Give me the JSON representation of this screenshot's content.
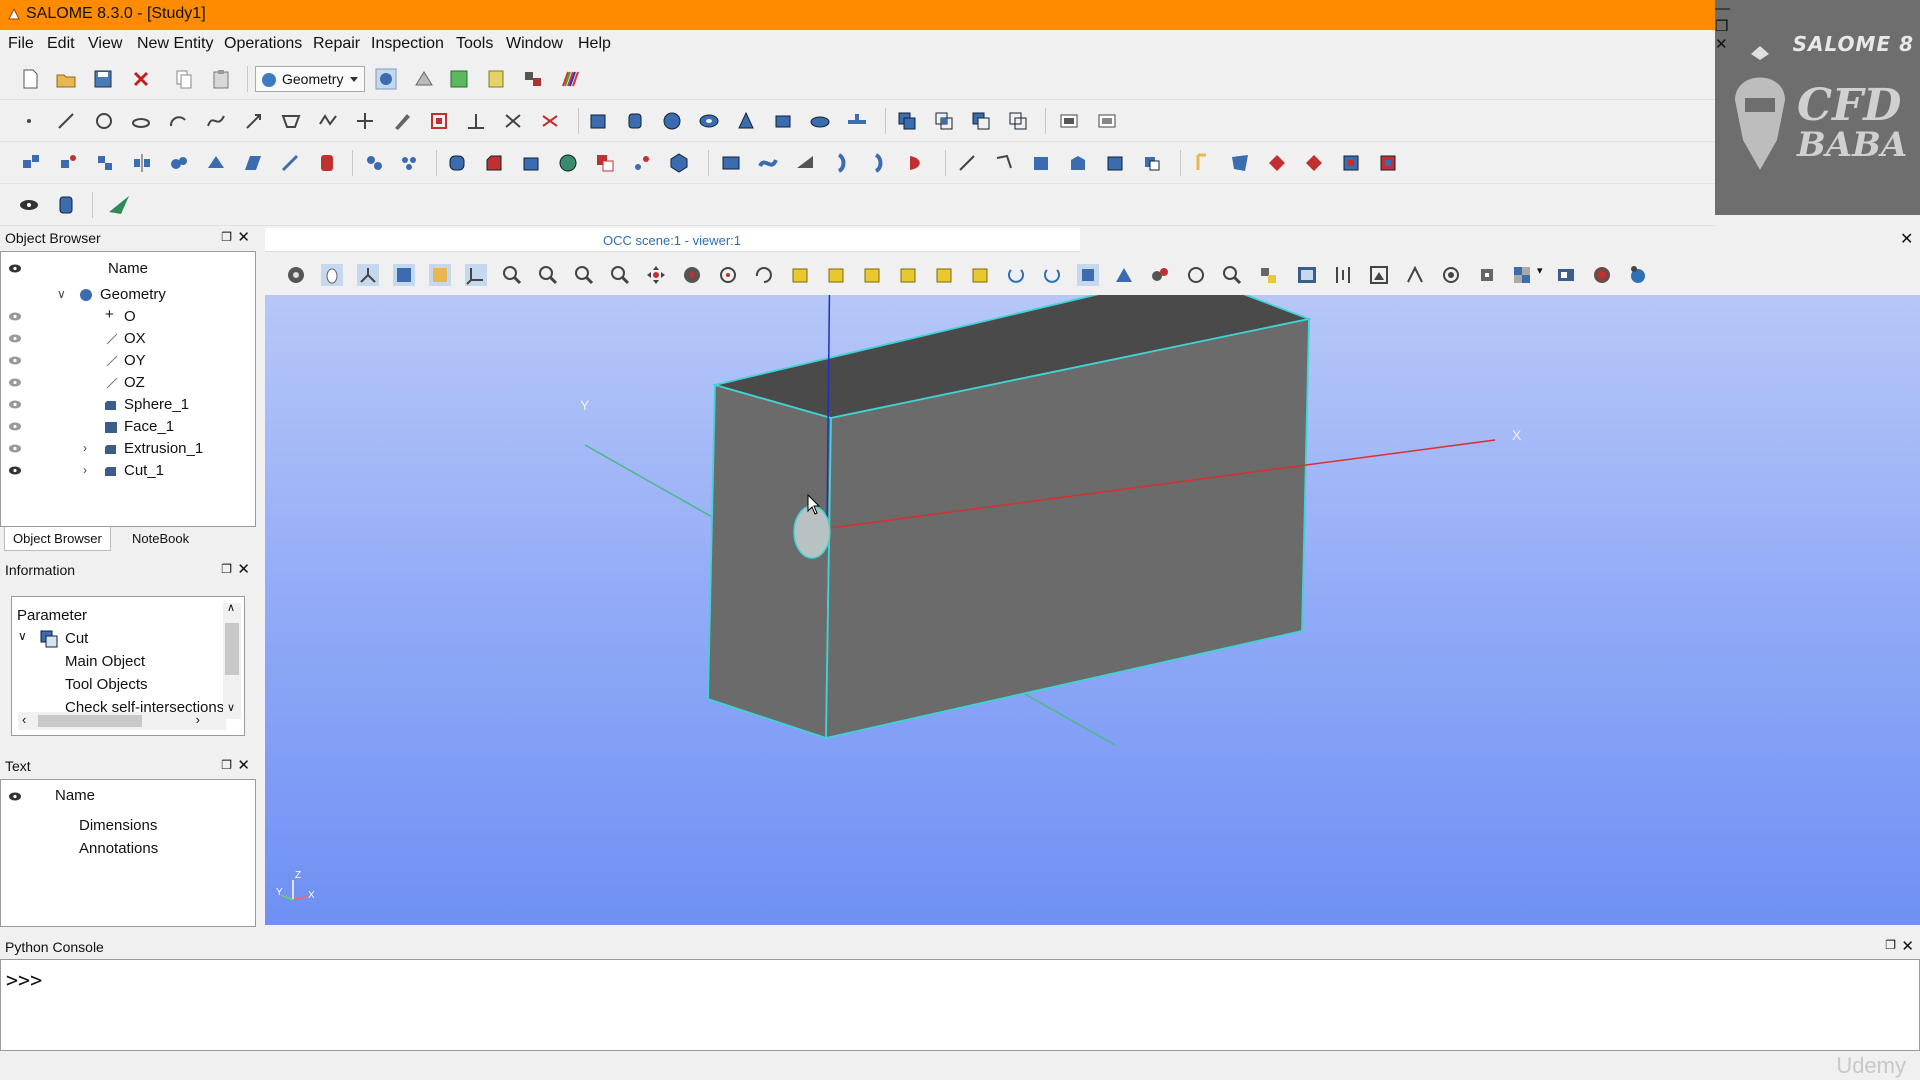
{
  "window": {
    "title": "SALOME 8.3.0 - [Study1]",
    "minimize": "—",
    "restore": "❒",
    "close": "✕"
  },
  "menu": [
    "File",
    "Edit",
    "View",
    "New Entity",
    "Operations",
    "Repair",
    "Inspection",
    "Tools",
    "Window",
    "Help"
  ],
  "module_selector": {
    "value": "Geometry"
  },
  "logo": {
    "line1": "SALOME 8",
    "line2": "CFD",
    "line3": "BABA"
  },
  "object_browser": {
    "title": "Object Browser",
    "column": "Name",
    "root": "Geometry",
    "items": [
      "O",
      "OX",
      "OY",
      "OZ",
      "Sphere_1",
      "Face_1",
      "Extrusion_1",
      "Cut_1"
    ],
    "tabs": [
      "Object Browser",
      "NoteBook"
    ]
  },
  "information": {
    "title": "Information",
    "header": "Parameter",
    "node": "Cut",
    "children": [
      "Main Object",
      "Tool Objects",
      "Check self-intersections"
    ]
  },
  "text_panel": {
    "title": "Text",
    "column": "Name",
    "items": [
      "Dimensions",
      "Annotations"
    ]
  },
  "viewer": {
    "tab_title": "OCC scene:1 - viewer:1",
    "axis_labels": {
      "x": "X",
      "y": "Y",
      "z": "Z"
    },
    "colors": {
      "box_face": "#6b6b6b",
      "box_top": "#4a4a4a",
      "box_edge": "#3fd3d3",
      "axis_x": "#d83030",
      "axis_y": "#4ab887",
      "axis_z": "#1f2fbf"
    }
  },
  "console": {
    "title": "Python Console",
    "prompt": ">>>"
  },
  "watermark": "Udemy",
  "dock_buttons": {
    "float": "❐",
    "close": "✕"
  }
}
